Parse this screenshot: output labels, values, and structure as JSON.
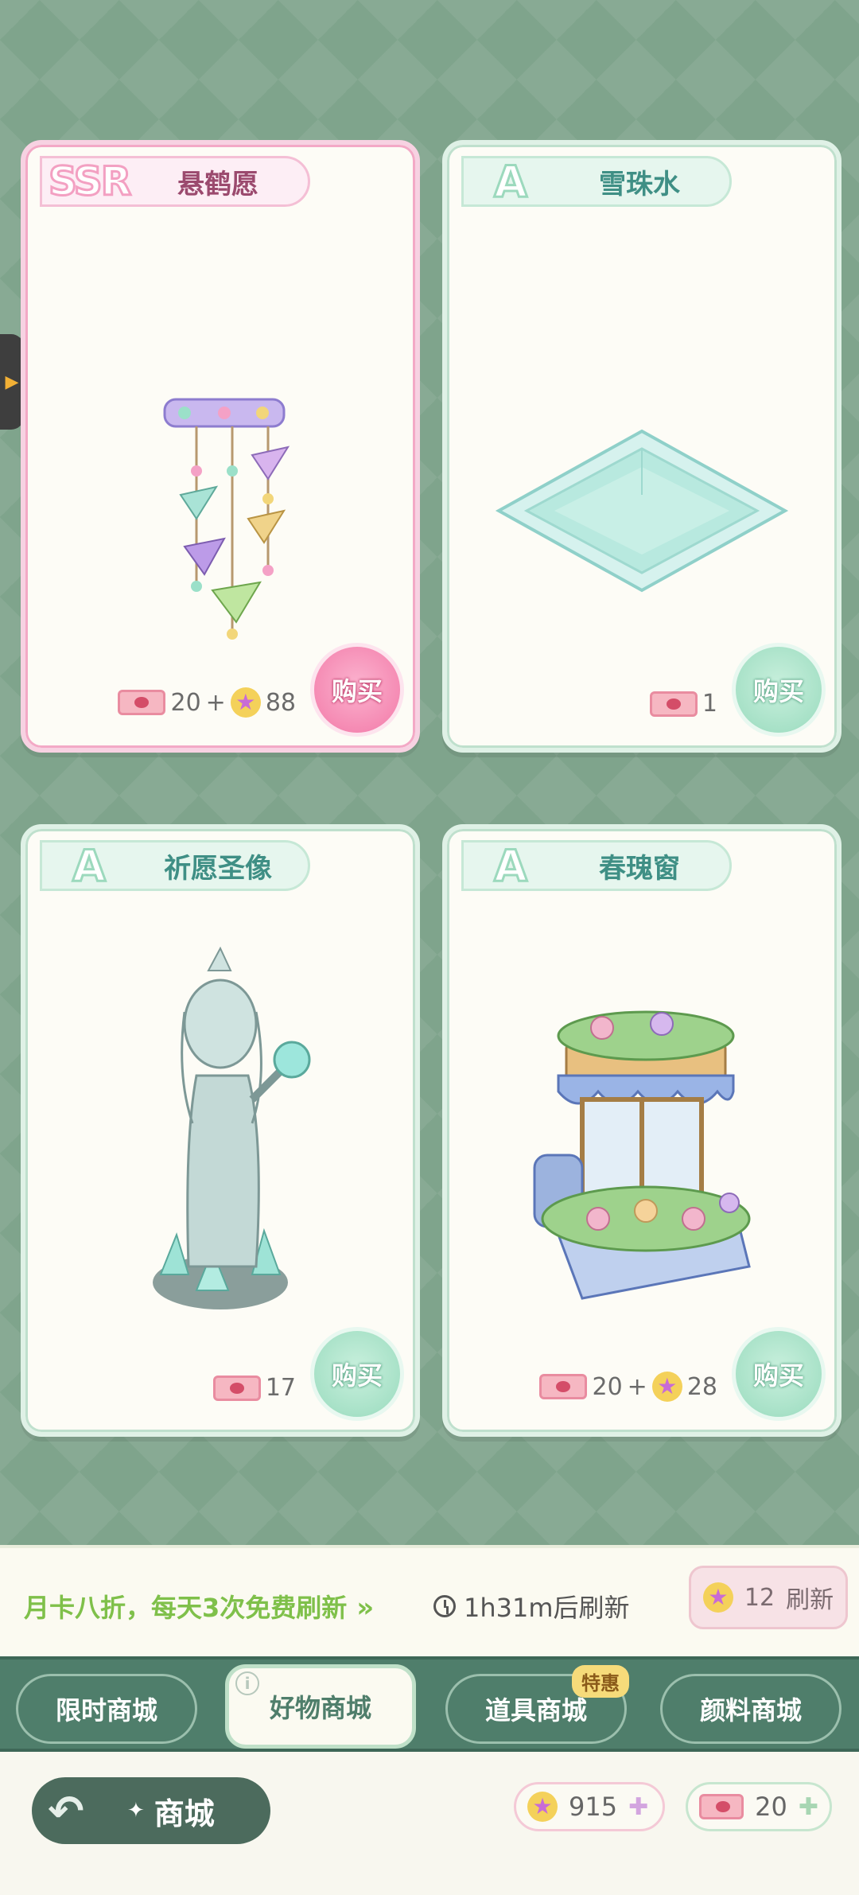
{
  "cards": [
    {
      "rarity": "SSR",
      "name": "悬鹤愿",
      "price_tickets": "20",
      "plus": "+",
      "price_stars": "88",
      "buy_label": "购买"
    },
    {
      "rarity": "A",
      "name": "雪珠水",
      "price_tickets": "1",
      "buy_label": "购买"
    },
    {
      "rarity": "A",
      "name": "祈愿圣像",
      "price_tickets": "17",
      "buy_label": "购买"
    },
    {
      "rarity": "A",
      "name": "春瑰窗",
      "price_tickets": "20",
      "plus": "+",
      "price_stars": "28",
      "buy_label": "购买"
    }
  ],
  "refresh": {
    "promo": "月卡八折，每天3次免费刷新",
    "timer": "1h31m后刷新",
    "cost": "12",
    "label": "刷新"
  },
  "tabs": [
    {
      "label": "限时商城"
    },
    {
      "label": "好物商城",
      "active": true
    },
    {
      "label": "道具商城",
      "badge": "特惠"
    },
    {
      "label": "颜料商城"
    }
  ],
  "footer": {
    "title": "商城",
    "stars": "915",
    "tickets": "20"
  },
  "colors": {
    "background": "#7fa48c",
    "tab_bar": "#4f7e6b",
    "ssr_accent": "#f58ab3",
    "a_accent": "#a7e1c7"
  }
}
